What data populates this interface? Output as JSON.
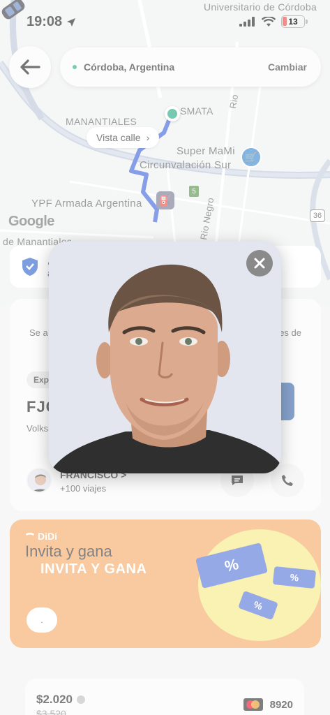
{
  "status_bar": {
    "time": "19:08",
    "battery": "13"
  },
  "map": {
    "labels": {
      "top": "Universitario de Córdoba",
      "manantiales": "MANANTIALES",
      "smata": "SMATA",
      "super": "Super MaMi",
      "circunvalacion": "Circunvalación Sur",
      "ypf": "YPF Armada Argentina",
      "de_manantiales": "de Manantiales",
      "rio_negro": "Rio Negro",
      "rio_top": "Rio",
      "route_5": "5",
      "route_36": "36",
      "google": "Google"
    },
    "street_view": "Vista calle"
  },
  "location_bar": {
    "city": "Córdoba, Argentina",
    "change": "Cambiar"
  },
  "safety": {
    "line1": "¿",
    "line2": "a"
  },
  "driver": {
    "notice_left": "Se a",
    "notice_right": "es de",
    "badge": "Expr",
    "plate": "FJC",
    "vehicle": "Volks",
    "name": "FRANCISCO >",
    "trips": "+100 viajes"
  },
  "promo": {
    "brand": "DiDi",
    "title": "Invita y gana",
    "headline": "INVITA Y GANA",
    "ticket_symbol": "%",
    "cta": "."
  },
  "payment": {
    "price": "$2.020",
    "old_price": "$3.520",
    "card_last4": "8920"
  }
}
